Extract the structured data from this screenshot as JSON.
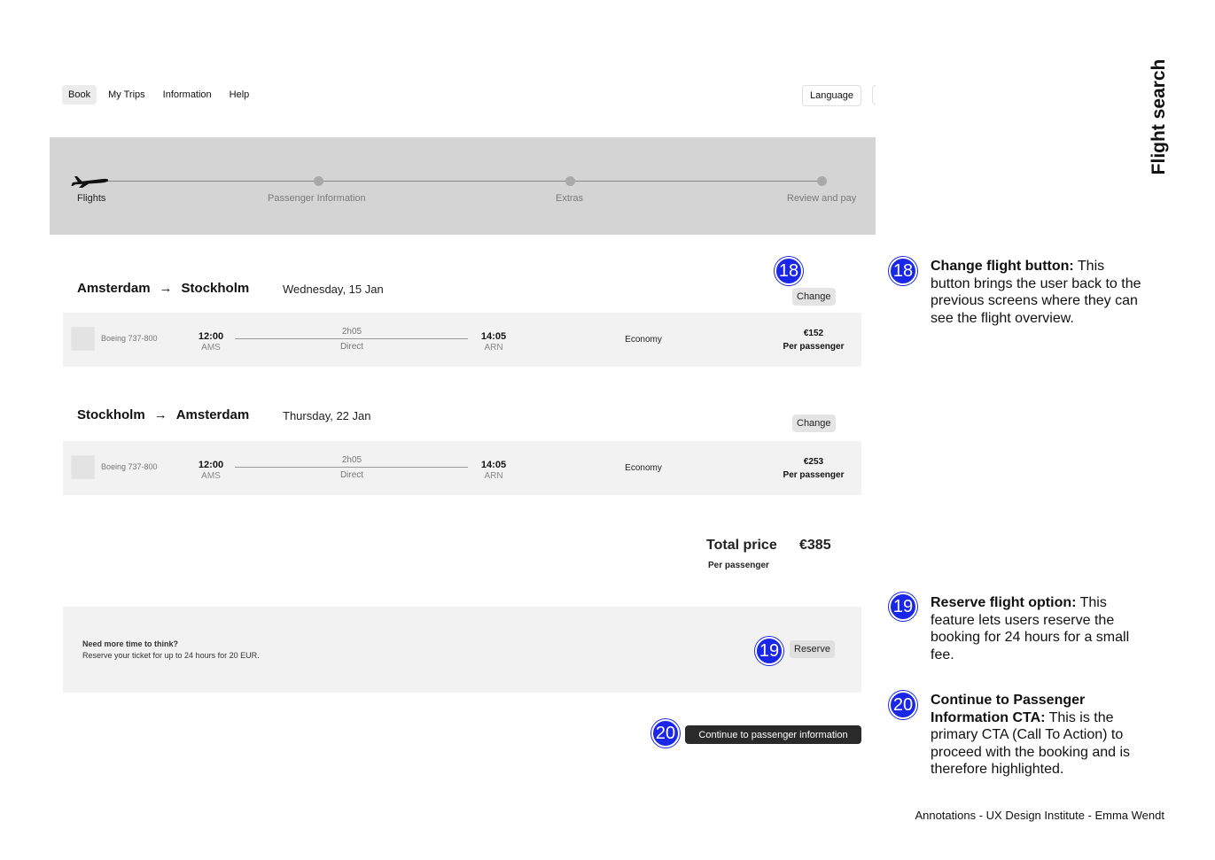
{
  "nav": {
    "items": [
      "Book",
      "My Trips",
      "Information",
      "Help"
    ],
    "language_label": "Language"
  },
  "progress": {
    "steps": [
      "Flights",
      "Passenger Information",
      "Extras",
      "Review and pay"
    ],
    "current_step": "Flights"
  },
  "trips": [
    {
      "origin": "Amsterdam",
      "destination": "Stockholm",
      "date": "Wednesday, 15 Jan",
      "change_label": "Change",
      "aircraft": "Boeing 737-800",
      "dep_time": "12:00",
      "dep_code": "AMS",
      "duration": "2h05",
      "stops": "Direct",
      "arr_time": "14:05",
      "arr_code": "ARN",
      "cabin": "Economy",
      "price": "€152",
      "price_note": "Per passenger"
    },
    {
      "origin": "Stockholm",
      "destination": "Amsterdam",
      "date": "Thursday, 22 Jan",
      "change_label": "Change",
      "aircraft": "Boeing 737-800",
      "dep_time": "12:00",
      "dep_code": "AMS",
      "duration": "2h05",
      "stops": "Direct",
      "arr_time": "14:05",
      "arr_code": "ARN",
      "cabin": "Economy",
      "price": "€253",
      "price_note": "Per passenger"
    }
  ],
  "total": {
    "label": "Total price",
    "value": "€385",
    "note": "Per passenger"
  },
  "reserve": {
    "title": "Need more time to think?",
    "text": "Reserve your ticket for up to 24 hours for 20 EUR.",
    "button_label": "Reserve"
  },
  "cta": {
    "label": "Continue to passenger information"
  },
  "badges": {
    "b18": "18",
    "b19": "19",
    "b20": "20"
  },
  "annotations": [
    {
      "number": "18",
      "title": "Change flight button:",
      "text": " This button brings the user back to the previous screens where they can see the flight overview."
    },
    {
      "number": "19",
      "title": "Reserve flight option:",
      "text": " This feature lets users reserve the booking for 24 hours for a small fee."
    },
    {
      "number": "20",
      "title": "Continue to Passenger Information CTA:",
      "text": " This is the primary CTA (Call To Action) to proceed with the booking and is therefore highlighted."
    }
  ],
  "page_title": "Flight search",
  "footer": "Annotations - UX Design Institute - Emma Wendt",
  "colors": {
    "badge": "#1a26e8",
    "cta": "#2a2a2a",
    "progress_band": "#d4d4d4",
    "row_bg": "#f2f2f2"
  }
}
